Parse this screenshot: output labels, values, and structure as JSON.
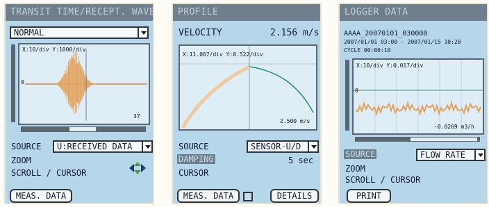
{
  "transit": {
    "title": "TRANSIT TIME/RECEPT. WAVE",
    "mode_select": "NORMAL",
    "graph_label": "X:10/div Y:1000/div",
    "zero_marker": "0",
    "value_readout": "37",
    "source_label": "SOURCE",
    "source_select": "U:RECEIVED DATA",
    "zoom_label": "ZOOM",
    "scroll_label": "SCROLL / CURSOR",
    "meas_button": "MEAS. DATA"
  },
  "profile": {
    "title": "PROFILE",
    "velocity_label": "VELOCITY",
    "velocity_value": "2.156 m/s",
    "graph_label": "X:11.067/div Y:0.522/div",
    "value_readout": "2.500 m/s",
    "source_label": "SOURCE",
    "source_select": "SENSOR-U/D",
    "damping_label": "DAMPING",
    "damping_value": "5 sec",
    "cursor_label": "CURSOR",
    "meas_button": "MEAS. DATA",
    "details_button": "DETAILS"
  },
  "logger": {
    "title": "LOGGER DATA",
    "file_name": "AAAA_20070101_030000",
    "date_range": "2007/01/01 03:00 - 2007/01/15 10:28",
    "cycle": "CYCLE 00:00:10",
    "graph_label": "X:10/div Y:0.017/div",
    "zero_marker": "0",
    "value_readout": "-0.0269 m3/h",
    "source_label": "SOURCE",
    "source_select": "FLOW RATE",
    "zoom_label": "ZOOM",
    "scroll_label": "SCROLL / CURSOR",
    "print_button": "PRINT"
  },
  "colors": {
    "panel_bg": "#b6d6ea",
    "titlebar_bg": "#6f7f8d",
    "wave_orange": "#e3a25a",
    "profile_green": "#1f8f6a"
  }
}
